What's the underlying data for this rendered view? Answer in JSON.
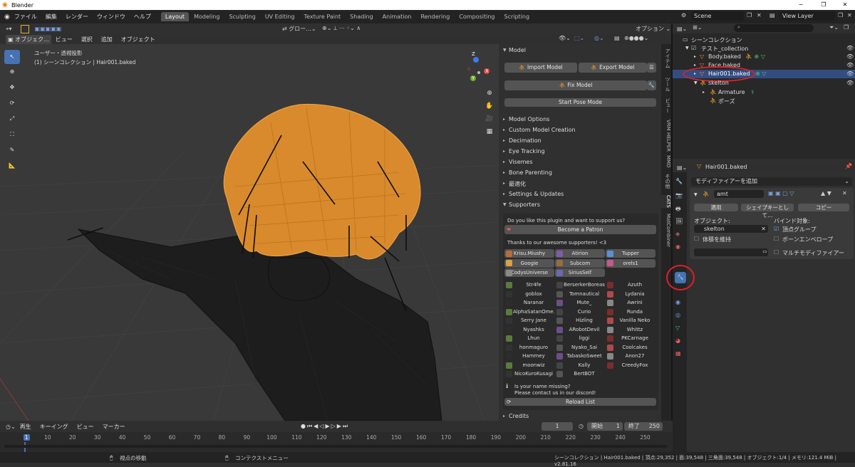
{
  "window": {
    "title": "Blender",
    "min": "─",
    "max": "❐",
    "close": "✕"
  },
  "menu": [
    "ファイル",
    "編集",
    "レンダー",
    "ウィンドウ",
    "ヘルプ"
  ],
  "workspaces": [
    "Layout",
    "Modeling",
    "Sculpting",
    "UV Editing",
    "Texture Paint",
    "Shading",
    "Animation",
    "Rendering",
    "Compositing",
    "Scripting"
  ],
  "active_workspace": "Layout",
  "scene": {
    "name": "Scene",
    "view_layer": "View Layer"
  },
  "viewport": {
    "header_mode": "オブジェク...",
    "header_menus": [
      "ビュー",
      "選択",
      "追加",
      "オブジェクト"
    ],
    "transform": "グロー...",
    "options": "オプション",
    "info_line1": "ユーザー・透視投影",
    "info_line2": "(1) シーンコレクション | Hair001.baked",
    "gizmo": {
      "x": "X",
      "y": "Y",
      "z": "Z"
    }
  },
  "cats": {
    "panel_title": "Model",
    "import": "Import Model",
    "export": "Export Model",
    "fix": "Fix Model",
    "pose": "Start Pose Mode",
    "sections": [
      "Model Options",
      "Custom Model Creation",
      "Decimation",
      "Eye Tracking",
      "Visemes",
      "Bone Parenting",
      "最適化",
      "Settings & Updates",
      "Supporters"
    ],
    "support_q": "Do you like this plugin and want to support us?",
    "patron": "Become a Patron",
    "thanks": "Thanks to our awesome supporters! <3",
    "top_supporters": [
      "Krisu.Miushy",
      "Atirion",
      "Tupper",
      "Googie",
      "Subcom",
      "orels1",
      "CodysUniverse",
      "SiriusSelf"
    ],
    "supporters": [
      "Str4fe",
      "BerserkerBoreas",
      "Azuth",
      "goblox",
      "Tomnautical",
      "Lydania",
      "Naranar",
      "Mute_",
      "Awrini",
      "AlphaSatanOme...",
      "Curio",
      "Runda",
      "Serry Jane",
      "Hizling",
      "Vanilla Neko",
      "Nyashks",
      "ARobotDevil",
      "Whittz",
      "Lhun",
      "liggi",
      "PKCarnage",
      "honmaguro",
      "Nyako_Sai",
      "Coolcakes",
      "Hammey",
      "TabaskoSweet",
      "Anon27",
      "moonwiz",
      "Kally",
      "CreedyFox",
      "NicoKuroKusagi",
      "BertBOT",
      ""
    ],
    "missing1": "Is your name missing?",
    "missing2": "Please contact us in our discord!",
    "reload": "Reload List",
    "credits": "Credits"
  },
  "side_tabs": [
    "アイテム",
    "ツール",
    "ビュー",
    "VRM HELPER",
    "MMD",
    "その他",
    "CATS",
    "MatCombiner"
  ],
  "outliner": {
    "root": "シーンコレクション",
    "collection": "テスト_collection",
    "items": [
      "Body.baked",
      "Face.baked",
      "Hair001.baked",
      "skelton",
      "Armature",
      "ポーズ"
    ]
  },
  "properties": {
    "object": "Hair001.baked",
    "add_modifier": "モディファイアーを追加",
    "modifier_name": "amt",
    "apply": "適用",
    "shape": "シェイプキーとして...",
    "copy": "コピー",
    "object_label": "オブジェクト:",
    "object_value": "skelton",
    "bind_label": "バインド対象:",
    "preserve": "体積を維持",
    "vgroup": "頂点グループ",
    "bone_env": "ボーンエンベロープ",
    "multi": "マルチモディファイアー"
  },
  "timeline": {
    "menus": [
      "再生",
      "キーイング",
      "ビュー",
      "マーカー"
    ],
    "current": "1",
    "start_label": "開始",
    "start": "1",
    "end_label": "終了",
    "end": "250",
    "ticks": [
      "1",
      "10",
      "20",
      "30",
      "40",
      "50",
      "60",
      "70",
      "80",
      "90",
      "100",
      "110",
      "120",
      "130",
      "140",
      "150",
      "160",
      "170",
      "180",
      "190",
      "200",
      "210",
      "220",
      "230",
      "240",
      "250"
    ]
  },
  "status": {
    "left": "視点の移動",
    "mid": "コンテクストメニュー",
    "right": "シーンコレクション | Hair001.baked | 頂点:29,352 | 面:39,548 | 三角面:39,548 | オブジェクト:1/4 | メモリ:121.4 MiB | v2.81.16"
  },
  "colors": {
    "accent": "#4772b3",
    "hair": "#e8952f",
    "highlight_circle": "#e0202a"
  }
}
